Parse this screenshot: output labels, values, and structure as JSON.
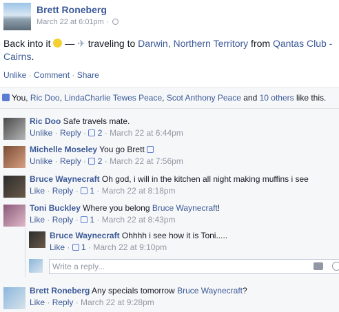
{
  "post": {
    "author": "Brett Roneberg",
    "timestamp": "March 22 at 6:01pm",
    "meta_sep": " · ",
    "text_start": "Back into it",
    "text_dash": " — ",
    "text_traveling": " traveling to ",
    "place": "Darwin, Northern Territory",
    "text_from": " from ",
    "origin": "Qantas Club - Cairns",
    "text_end": ".",
    "actions": {
      "unlike": "Unlike",
      "comment": "Comment",
      "share": "Share",
      "sep": " · "
    }
  },
  "likes": {
    "prefix": "You, ",
    "people": [
      "Ric Doo",
      "LindaCharlie Tewes Peace",
      "Scot Anthony Peace"
    ],
    "sep": ", ",
    "and": " and ",
    "others": "10 others",
    "suffix": " like this."
  },
  "comments": [
    {
      "author": "Ric Doo",
      "text": " Safe travels mate.",
      "action": "Unlike",
      "reply": "Reply",
      "likes": "2",
      "time": "March 22 at 6:44pm"
    },
    {
      "author": "Michelle Moseley",
      "text": " You go Brett",
      "action": "Unlike",
      "reply": "Reply",
      "likes": "2",
      "time": "March 22 at 7:56pm"
    },
    {
      "author": "Bruce Waynecraft",
      "text": " Oh god, i will in the kitchen all night making muffins i see",
      "action": "Like",
      "reply": "Reply",
      "likes": "1",
      "time": "March 22 at 8:18pm"
    },
    {
      "author": "Toni Buckley",
      "text_before": " Where you belong ",
      "mention": "Bruce Waynecraft",
      "text_after": "!",
      "action": "Like",
      "reply": "Reply",
      "likes": "1",
      "time": "March 22 at 8:43pm"
    },
    {
      "author": "Brett Roneberg",
      "text_before": " Any specials tomorrow ",
      "mention": "Bruce Waynecraft",
      "text_after": "?",
      "action": "Like",
      "reply": "Reply",
      "time": "March 22 at 9:28pm"
    }
  ],
  "reply": {
    "author": "Bruce Waynecraft",
    "text": " Ohhhh i see how it is Toni.....",
    "action": "Like",
    "likes": "1",
    "time": "March 22 at 9:10pm",
    "placeholder": "Write a reply..."
  },
  "sep": " · ",
  "icons": {
    "globe": "globe-icon",
    "emoji": "smiley-icon",
    "plane": "airplane-icon",
    "like": "thumbs-up-icon",
    "camera": "camera-icon",
    "smile": "emoji-icon"
  },
  "colors": {
    "link": "#3b5998",
    "meta": "#9197a3",
    "ufi_bg": "#f6f7f8"
  }
}
